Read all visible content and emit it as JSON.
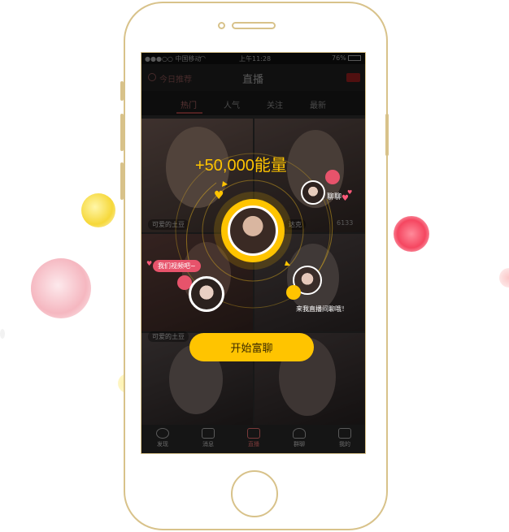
{
  "status_bar": {
    "carrier": "●●●○○ 中国移动",
    "time": "上午11:28",
    "battery": "76%"
  },
  "nav": {
    "left_label": "今日推荐",
    "title": "直播"
  },
  "tabs": [
    "热门",
    "人气",
    "关注",
    "最新"
  ],
  "active_tab": 0,
  "feed_tags": {
    "tag1": "可爱的土豆",
    "tag2": "可爱的土豆",
    "tag3": "达克",
    "count": "6133"
  },
  "promo": {
    "energy_text": "+50,000能量",
    "bubble_video": "我们视频吧~",
    "bubble_chat": "聊聊",
    "bubble_invite": "来我直播间聊哦！",
    "cta_label": "开始富聊"
  },
  "tabbar": [
    "发现",
    "消息",
    "直播",
    "群聊",
    "我的"
  ],
  "colors": {
    "accent_yellow": "#ffc400",
    "accent_pink": "#e7536b",
    "frame_gold": "#d8c28a"
  }
}
